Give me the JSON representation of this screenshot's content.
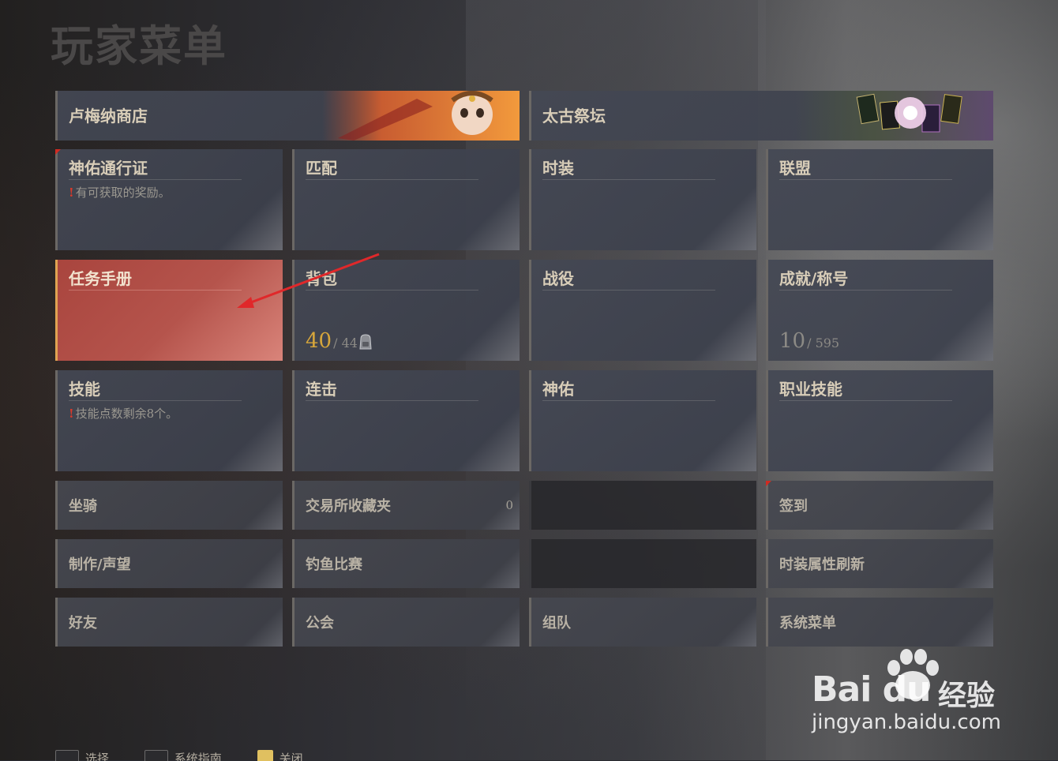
{
  "title": "玩家菜单",
  "banners": [
    {
      "label": "卢梅纳商店"
    },
    {
      "label": "太古祭坛"
    }
  ],
  "tiles": {
    "pass": {
      "label": "神佑通行证",
      "note": "有可获取的奖励。"
    },
    "match": {
      "label": "匹配"
    },
    "fashion": {
      "label": "时装"
    },
    "alliance": {
      "label": "联盟"
    },
    "quest": {
      "label": "任务手册"
    },
    "bag": {
      "label": "背包",
      "count": "40",
      "max": "/ 44"
    },
    "campaign": {
      "label": "战役"
    },
    "achievement": {
      "label": "成就/称号",
      "count": "10",
      "max": "/ 595"
    },
    "skill": {
      "label": "技能",
      "note": "技能点数剩余8个。"
    },
    "combo": {
      "label": "连击"
    },
    "blessing": {
      "label": "神佑"
    },
    "class_skill": {
      "label": "职业技能"
    }
  },
  "small_tiles": {
    "mount": "坐骑",
    "trade_fav": "交易所收藏夹",
    "trade_fav_count": "0",
    "checkin": "签到",
    "craft": "制作/声望",
    "fishing": "钓鱼比赛",
    "fashion_refresh": "时装属性刷新",
    "friends": "好友",
    "guild": "公会",
    "party": "组队",
    "system_menu": "系统菜单"
  },
  "footer": {
    "select": "选择",
    "system_nav": "系统指南",
    "close": "关闭"
  },
  "watermark": {
    "logo": "Bai du",
    "cn": "经验",
    "url": "jingyan.baidu.com"
  },
  "colors": {
    "accent_gold": "#d6a63b",
    "active_tile": "#b5544c",
    "alert_red": "#d93a2b"
  }
}
